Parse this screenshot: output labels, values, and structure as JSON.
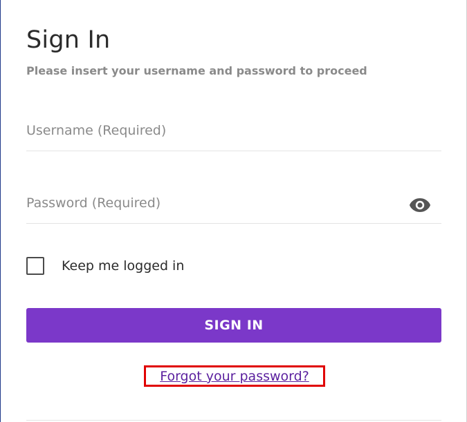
{
  "form": {
    "title": "Sign In",
    "subtitle": "Please insert your username and password to proceed",
    "username": {
      "value": "",
      "placeholder": "Username (Required)"
    },
    "password": {
      "value": "",
      "placeholder": "Password (Required)",
      "toggle_icon": "eye-icon"
    },
    "remember": {
      "label": "Keep me logged in",
      "checked": false
    },
    "submit_label": "SIGN IN",
    "forgot_label": "Forgot your password?"
  },
  "colors": {
    "primary": "#7b38c9",
    "link": "#5a1f9e",
    "highlight_border": "#e00000",
    "text": "#2b2b2b",
    "muted": "#8a8a8a"
  }
}
